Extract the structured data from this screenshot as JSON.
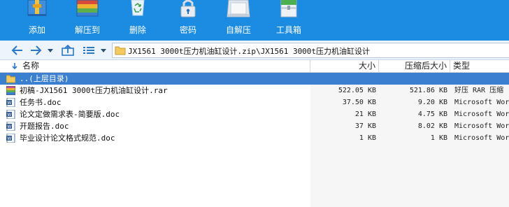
{
  "toolbar": {
    "add_label": "添加",
    "extract_to_label": "解压到",
    "delete_label": "删除",
    "password_label": "密码",
    "sfx_label": "自解压",
    "toolbox_label": "工具箱"
  },
  "address": {
    "path": "JX1561 3000t压力机油缸设计.zip\\JX1561 3000t压力机油缸设计"
  },
  "columns": {
    "name": "名称",
    "size": "大小",
    "packed": "压缩后大小",
    "type": "类型"
  },
  "files": [
    {
      "name": "..(上层目录)",
      "size": "",
      "packed": "",
      "type": "",
      "icon": "folder-up-icon",
      "selected": true
    },
    {
      "name": "初稿-JX1561 3000t压力机油缸设计.rar",
      "size": "522.05 KB",
      "packed": "521.86 KB",
      "type": "好压 RAR 压缩",
      "icon": "rar-archive-icon",
      "selected": false
    },
    {
      "name": "任务书.doc",
      "size": "37.50 KB",
      "packed": "9.20 KB",
      "type": "Microsoft Wor",
      "icon": "doc-file-icon",
      "selected": false
    },
    {
      "name": "论文定做需求表-简要版.doc",
      "size": "21 KB",
      "packed": "4.75 KB",
      "type": "Microsoft Wor",
      "icon": "doc-file-icon",
      "selected": false
    },
    {
      "name": "开题报告.doc",
      "size": "37 KB",
      "packed": "8.02 KB",
      "type": "Microsoft Wor",
      "icon": "doc-file-icon",
      "selected": false
    },
    {
      "name": "毕业设计论文格式规范.doc",
      "size": "1 KB",
      "packed": "1 KB",
      "type": "Microsoft Wor",
      "icon": "doc-file-icon",
      "selected": false
    }
  ],
  "colors": {
    "toolbar_bg": "#1c8ce3",
    "selected_row": "#3b7fd0",
    "address_bg": "#eef4fb"
  }
}
